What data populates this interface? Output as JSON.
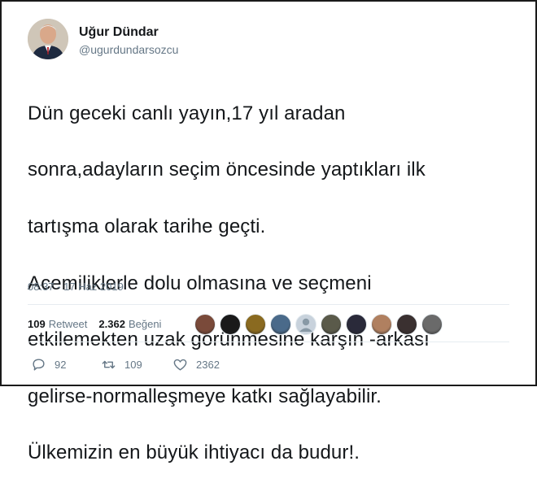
{
  "author": {
    "name": "Uğur Dündar",
    "handle": "@ugurdundarsozcu"
  },
  "tweet": {
    "lines": [
      "Dün geceki canlı yayın,17 yıl aradan",
      "sonra,adayların seçim öncesinde yaptıkları ilk",
      "tartışma olarak tarihe geçti.",
      "Acemiliklerle dolu olmasına ve seçmeni",
      "etkilemekten uzak görünmesine karşın -arkası",
      "gelirse-normalleşmeye katkı sağlayabilir.",
      "Ülkemizin en büyük ihtiyacı da budur!."
    ],
    "timestamp": "08:37 - 17 Haz 2019"
  },
  "stats": {
    "retweet_count": "109",
    "retweet_label": "Retweet",
    "like_count": "2.362",
    "like_label": "Beğeni"
  },
  "likers": [
    {
      "icon": "avatar",
      "color": "#7a4a3a"
    },
    {
      "icon": "avatar",
      "color": "#1a1a1a"
    },
    {
      "icon": "avatar",
      "color": "#8a6a20"
    },
    {
      "icon": "avatar",
      "color": "#4a6a8a"
    },
    {
      "icon": "default-avatar",
      "color": "#c8d2dc"
    },
    {
      "icon": "avatar",
      "color": "#5a5a4a"
    },
    {
      "icon": "avatar",
      "color": "#2a2a3a"
    },
    {
      "icon": "avatar",
      "color": "#b08060"
    },
    {
      "icon": "avatar",
      "color": "#3a3030"
    },
    {
      "icon": "avatar",
      "color": "#6a6a6a"
    }
  ],
  "actions": {
    "reply_count": "92",
    "retweet_count": "109",
    "like_count": "2362"
  },
  "colors": {
    "text": "#14171a",
    "secondary": "#657786",
    "divider": "#e6ecf0"
  }
}
